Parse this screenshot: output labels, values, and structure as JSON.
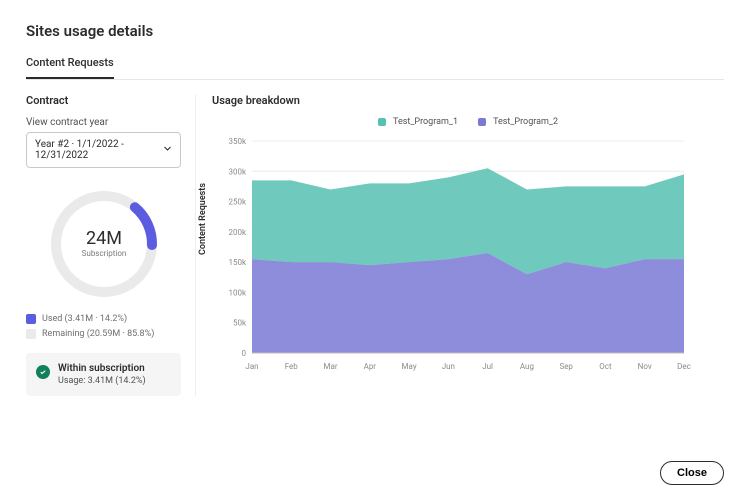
{
  "title": "Sites usage details",
  "tabs": [
    {
      "label": "Content Requests",
      "active": true
    }
  ],
  "contract": {
    "heading": "Contract",
    "year_label": "View contract year",
    "year_value": "Year #2  ·  1/1/2022 - 12/31/2022",
    "subscription_value": "24M",
    "subscription_label": "Subscription",
    "used_pct": 14.2,
    "legend_used": "Used (3.41M · 14.2%)",
    "legend_remaining": "Remaining (20.59M · 85.8%)",
    "status_title": "Within subscription",
    "status_sub": "Usage: 3.41M (14.2%)"
  },
  "breakdown_heading": "Usage breakdown",
  "close_label": "Close",
  "colors": {
    "series1": "#56c1b2",
    "series2": "#7a79d6",
    "gauge_track": "#eaeaea",
    "gauge_fill": "#5c5ce0",
    "status_ok": "#12805c"
  },
  "chart_data": {
    "type": "area",
    "title": "Usage breakdown",
    "xlabel": "",
    "ylabel": "Content Requests",
    "ylim": [
      0,
      350000
    ],
    "yticks": [
      "0",
      "50k",
      "100k",
      "150k",
      "200k",
      "250k",
      "300k",
      "350k"
    ],
    "categories": [
      "Jan",
      "Feb",
      "Mar",
      "Apr",
      "May",
      "Jun",
      "Jul",
      "Aug",
      "Sep",
      "Oct",
      "Nov",
      "Dec"
    ],
    "series": [
      {
        "name": "Test_Program_1",
        "color": "#56c1b2",
        "stack_top": [
          285000,
          285000,
          270000,
          280000,
          280000,
          290000,
          305000,
          270000,
          275000,
          275000,
          275000,
          295000
        ]
      },
      {
        "name": "Test_Program_2",
        "color": "#7a79d6",
        "stack_top": [
          155000,
          150000,
          150000,
          145000,
          150000,
          155000,
          165000,
          130000,
          150000,
          140000,
          155000,
          155000
        ]
      }
    ],
    "note": "stacked area; each series' stack_top is the cumulative height (from zero). Test_Program_2 area is from 0 to its stack_top; Test_Program_1 area is from Test_Program_2.stack_top to Test_Program_1.stack_top."
  }
}
